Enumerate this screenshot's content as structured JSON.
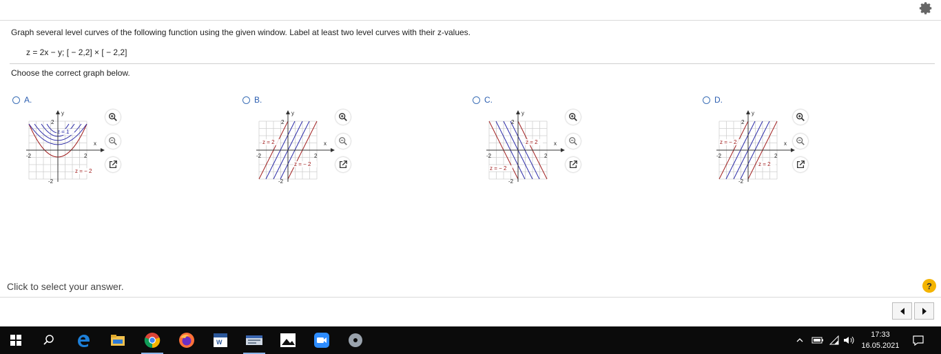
{
  "question": {
    "prompt": "Graph several level curves of the following function using the given window. Label at least two level curves with their z-values.",
    "formula": "z = 2x − y;  [ − 2,2] × [ − 2,2]",
    "instruction": "Choose the correct graph below."
  },
  "options": [
    {
      "letter": "A.",
      "labels": [
        "z = 1",
        "z = − 2"
      ]
    },
    {
      "letter": "B.",
      "labels": [
        "z = 2",
        "z = − 2"
      ]
    },
    {
      "letter": "C.",
      "labels": [
        "z = 2",
        "z = − 2"
      ]
    },
    {
      "letter": "D.",
      "labels": [
        "z = − 2",
        "z = 2"
      ]
    }
  ],
  "axis": {
    "y": "y",
    "x": "x",
    "top": "2",
    "bottom": "-2",
    "left": "-2",
    "right": "2"
  },
  "footer": {
    "select_text": "Click to select your answer.",
    "help": "?"
  },
  "taskbar": {
    "time": "17:33",
    "date": "16.05.2021"
  },
  "colors": {
    "accent": "#2a5db0",
    "curve_blue": "#2a2aa8",
    "curve_red": "#a01c1c",
    "grid": "#cfcfcf",
    "taskbar": "#0b0b0b"
  },
  "icons": [
    "gear-icon",
    "zoom-in-icon",
    "zoom-out-icon",
    "popout-icon",
    "help-icon",
    "prev-arrow-icon",
    "next-arrow-icon",
    "windows-start-icon",
    "search-icon",
    "edge-icon",
    "file-explorer-icon",
    "chrome-icon",
    "firefox-icon",
    "word-icon",
    "app-icon",
    "photos-icon",
    "camera-icon",
    "disc-icon",
    "chevron-up-icon",
    "battery-icon",
    "wifi-icon",
    "volume-icon",
    "notification-icon"
  ]
}
